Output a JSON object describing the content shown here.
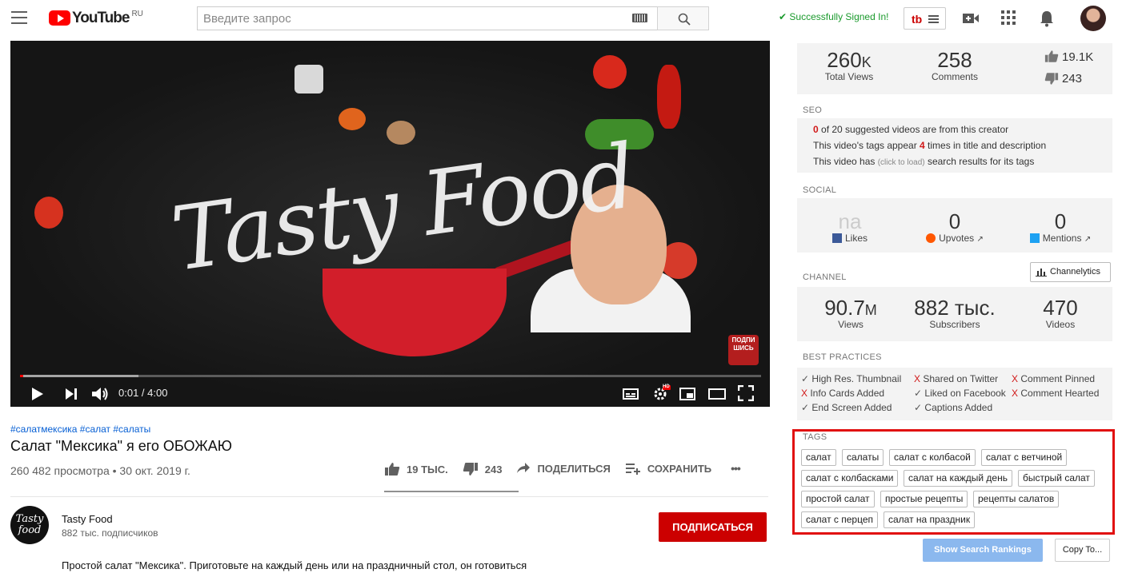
{
  "header": {
    "logo_text": "YouTube",
    "logo_region": "RU",
    "search_placeholder": "Введите запрос",
    "signed_in_text": "Successfully Signed In!",
    "tubebuddy_label": "tb"
  },
  "player": {
    "time": "0:01 / 4:00",
    "progress_played": 0.004,
    "progress_loaded": 0.16,
    "art_text": "Tasty Food",
    "subscribe_badge": "ПОДПИ ШИСЬ",
    "hd_badge": "HD"
  },
  "video": {
    "hashtags": "#салатмексика #салат #салаты",
    "title": "Салат \"Мексика\" я его ОБОЖАЮ",
    "views_date": "260 482 просмотра • 30 окт. 2019 г.",
    "like_count": "19 ТЫС.",
    "dislike_count": "243",
    "share_label": "ПОДЕЛИТЬСЯ",
    "save_label": "СОХРАНИТЬ",
    "more_label": "•••"
  },
  "channel": {
    "avatar_text": "Tasty food",
    "name": "Tasty Food",
    "subscribers": "882 тыс. подписчиков",
    "subscribe_label": "ПОДПИСАТЬСЯ",
    "description": "Простой салат \"Мексика\". Приготовьте на каждый день или на праздничный стол, он готовиться"
  },
  "sidebar": {
    "overview": {
      "views_value": "260",
      "views_suffix": "K",
      "views_label": "Total Views",
      "comments_value": "258",
      "comments_label": "Comments",
      "likes": "19.1K",
      "dislikes": "243"
    },
    "seo": {
      "section_label": "SEO",
      "line1_num": "0",
      "line1_text": " of 20 suggested videos are from this creator",
      "line2_pre": "This video's tags appear ",
      "line2_num": "4",
      "line2_post": " times in title and description",
      "line3_pre": "This video has ",
      "line3_link": "(click to load)",
      "line3_post": " search results for its tags"
    },
    "social": {
      "section_label": "SOCIAL",
      "likes_value": "na",
      "likes_label": "Likes",
      "upvotes_value": "0",
      "upvotes_label": "Upvotes",
      "mentions_value": "0",
      "mentions_label": "Mentions"
    },
    "channel": {
      "section_label": "CHANNEL",
      "channelytics_label": "Channelytics",
      "views_value": "90.7",
      "views_suffix": "M",
      "views_label": "Views",
      "subs_value": "882 тыс.",
      "subs_label": "Subscribers",
      "videos_value": "470",
      "videos_label": "Videos"
    },
    "best_practices": {
      "section_label": "BEST PRACTICES",
      "items": [
        {
          "mark": "✓",
          "label": "High Res. Thumbnail",
          "ok": true
        },
        {
          "mark": "X",
          "label": "Shared on Twitter",
          "ok": false
        },
        {
          "mark": "X",
          "label": "Comment Pinned",
          "ok": false
        },
        {
          "mark": "X",
          "label": "Info Cards Added",
          "ok": false
        },
        {
          "mark": "✓",
          "label": "Liked on Facebook",
          "ok": true
        },
        {
          "mark": "X",
          "label": "Comment Hearted",
          "ok": false
        },
        {
          "mark": "✓",
          "label": "End Screen Added",
          "ok": true
        },
        {
          "mark": "✓",
          "label": "Captions Added",
          "ok": true
        }
      ]
    },
    "tags": {
      "section_label": "TAGS",
      "items": [
        "салат",
        "салаты",
        "салат с колбасой",
        "салат с ветчиной",
        "салат с колбасками",
        "салат на каждый день",
        "быстрый салат",
        "простой салат",
        "простые рецепты",
        "рецепты салатов",
        "салат с перцеп",
        "салат на праздник"
      ]
    },
    "show_rankings_label": "Show Search Rankings",
    "copy_label": "Copy To..."
  }
}
